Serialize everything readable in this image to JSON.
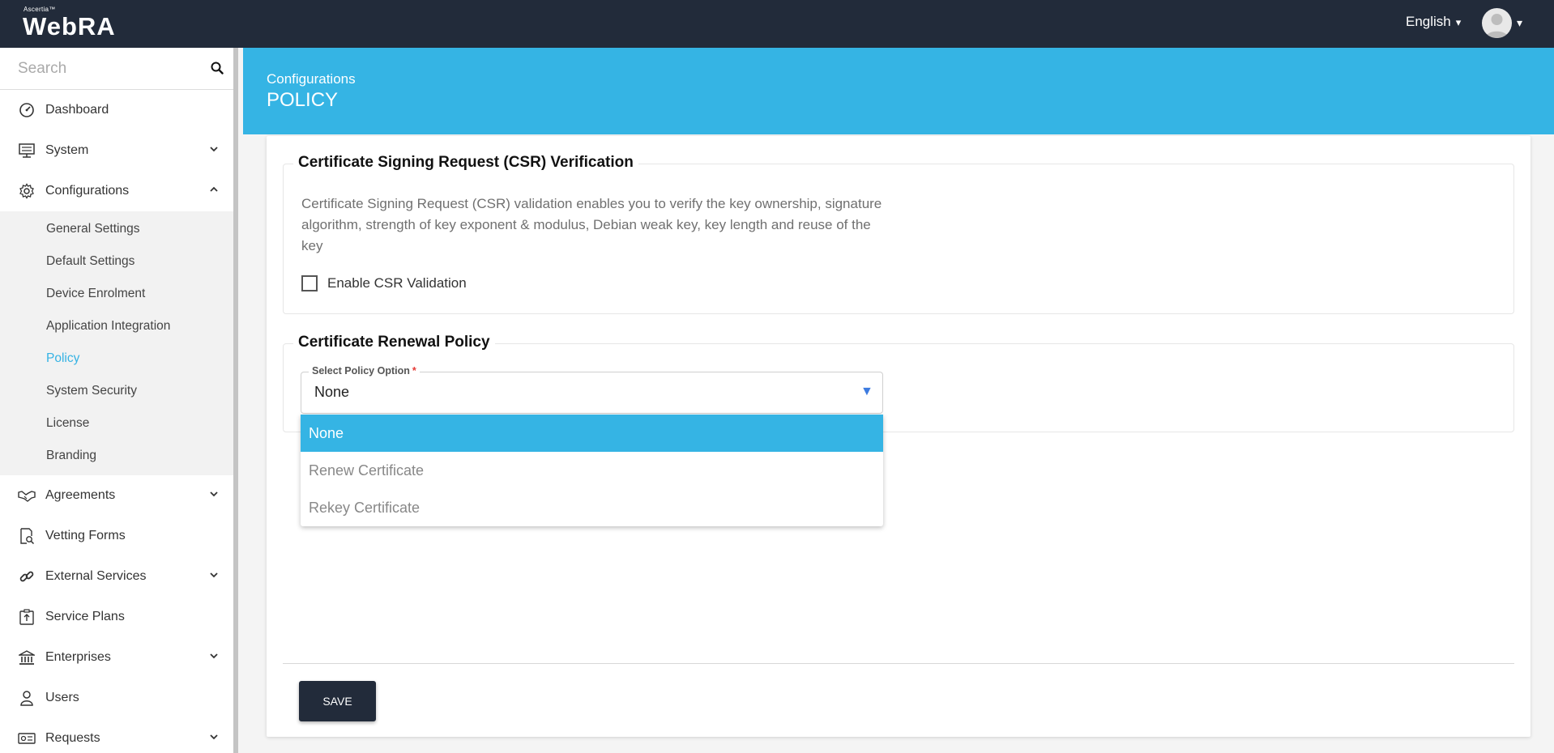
{
  "app": {
    "brand_small": "Ascertia™",
    "brand_name": "WebRA",
    "language": "English",
    "language_caret": "▾",
    "avatar_caret": "▾"
  },
  "sidebar": {
    "search_placeholder": "Search",
    "items": [
      {
        "label": "Dashboard",
        "icon": "dashboard-icon"
      },
      {
        "label": "System",
        "icon": "system-icon",
        "expandable": true
      },
      {
        "label": "Configurations",
        "icon": "gear-icon",
        "expanded": true,
        "children": [
          "General Settings",
          "Default Settings",
          "Device Enrolment",
          "Application Integration",
          "Policy",
          "System Security",
          "License",
          "Branding"
        ],
        "active_child": "Policy"
      },
      {
        "label": "Agreements",
        "icon": "handshake-icon",
        "expandable": true
      },
      {
        "label": "Vetting Forms",
        "icon": "vetting-forms-icon"
      },
      {
        "label": "External Services",
        "icon": "link-icon",
        "expandable": true
      },
      {
        "label": "Service Plans",
        "icon": "service-plans-icon"
      },
      {
        "label": "Enterprises",
        "icon": "bank-icon",
        "expandable": true
      },
      {
        "label": "Users",
        "icon": "users-icon"
      },
      {
        "label": "Requests",
        "icon": "requests-icon",
        "expandable": true
      }
    ]
  },
  "header": {
    "breadcrumb": "Configurations",
    "title": "POLICY"
  },
  "csr": {
    "legend": "Certificate Signing Request (CSR) Verification",
    "description": "Certificate Signing Request (CSR) validation enables you to verify the key ownership, signature algorithm, strength of key exponent & modulus, Debian weak key, key length and reuse of the key",
    "checkbox_label": "Enable CSR Validation",
    "checked": false
  },
  "renewal": {
    "legend": "Certificate Renewal Policy",
    "select_label": "Select Policy Option",
    "required_marker": "*",
    "selected_value": "None",
    "options": [
      "None",
      "Renew Certificate",
      "Rekey Certificate"
    ]
  },
  "actions": {
    "save_label": "SAVE"
  },
  "colors": {
    "topbar": "#222b3a",
    "accent": "#35b4e4",
    "dropdown_arrow": "#3d7be0"
  }
}
